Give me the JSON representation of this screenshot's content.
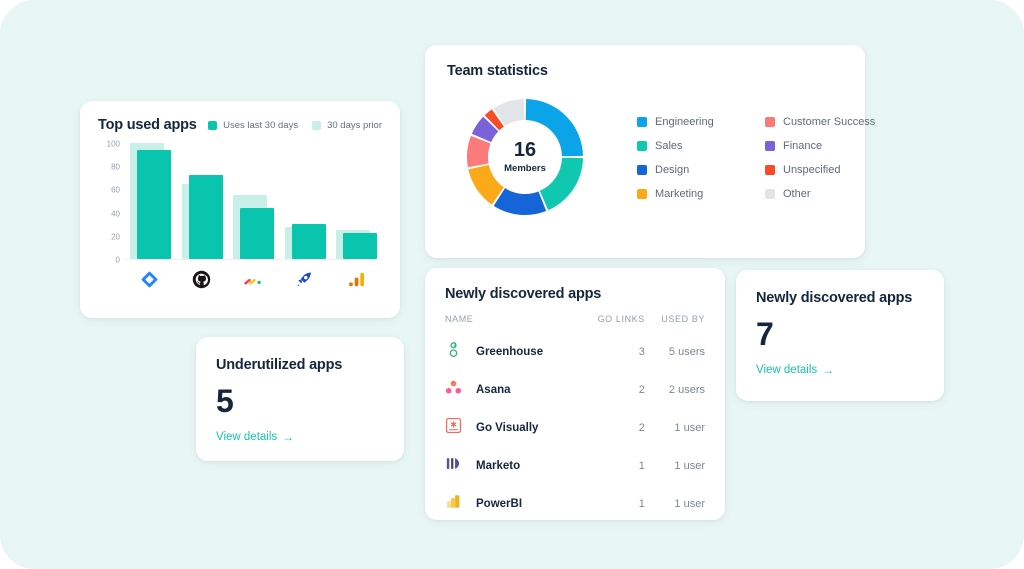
{
  "theme": {
    "background": "#e9f7f4",
    "card_background": "#ffffff",
    "text_dark": "#16263c",
    "text_muted": "#7b8893",
    "accent_teal": "#14c6ae"
  },
  "top_used_apps": {
    "title": "Top used apps",
    "legend": [
      {
        "label": "Uses last 30 days",
        "color": "#0ac5ad"
      },
      {
        "label": "30 days prior",
        "color": "#c9efe9"
      }
    ],
    "chart_data": {
      "type": "bar",
      "title": "Top used apps",
      "xlabel": "",
      "ylabel": "",
      "ylim": [
        0,
        100
      ],
      "yticks": [
        100,
        80,
        60,
        40,
        20,
        0
      ],
      "grid": false,
      "legend_position": "top-right",
      "categories": [
        "Jira",
        "GitHub",
        "Monday.com",
        "Salesloft",
        "Google Analytics"
      ],
      "series": [
        {
          "name": "Uses last 30 days",
          "color": "#0ac5ad",
          "values": [
            94,
            72,
            44,
            30,
            22
          ]
        },
        {
          "name": "30 days prior",
          "color": "#c9efe9",
          "values": [
            100,
            65,
            55,
            28,
            25
          ]
        }
      ]
    },
    "app_icons": [
      "jira-icon",
      "github-icon",
      "monday-icon",
      "salesloft-icon",
      "google-analytics-icon"
    ]
  },
  "team_statistics": {
    "title": "Team statistics",
    "center_value": "16",
    "center_caption": "Members",
    "chart_data": {
      "type": "pie",
      "title": "Team statistics",
      "total": 16,
      "total_label": "Members",
      "legend_position": "right",
      "categories": [
        "Engineering",
        "Sales",
        "Design",
        "Marketing",
        "Customer Success",
        "Finance",
        "Unspecified",
        "Other"
      ],
      "values": [
        4,
        3,
        2.5,
        2,
        1.5,
        1,
        0.5,
        1.5
      ],
      "colors": [
        "#0ca4e8",
        "#10c8b0",
        "#1565d8",
        "#fba918",
        "#fb7a7a",
        "#7b62db",
        "#f94b2a",
        "#e2e5e8"
      ]
    },
    "legend_left": [
      {
        "label": "Engineering",
        "color": "#0ca4e8"
      },
      {
        "label": "Sales",
        "color": "#10c8b0"
      },
      {
        "label": "Design",
        "color": "#1565d8"
      },
      {
        "label": "Marketing",
        "color": "#fba918"
      }
    ],
    "legend_right": [
      {
        "label": "Customer Success",
        "color": "#fb7a7a"
      },
      {
        "label": "Finance",
        "color": "#7b62db"
      },
      {
        "label": "Unspecified",
        "color": "#f94b2a"
      },
      {
        "label": "Other",
        "color": "#e2e5e8"
      }
    ]
  },
  "underutilized_apps": {
    "title": "Underutilized apps",
    "count": "5",
    "link_label": "View details",
    "link_arrow": "→"
  },
  "newly_discovered_count": {
    "title": "Newly discovered apps",
    "count": "7",
    "link_label": "View details",
    "link_arrow": "→"
  },
  "newly_discovered_table": {
    "title": "Newly discovered apps",
    "columns": [
      "NAME",
      "GO LINKS",
      "USED BY"
    ],
    "rows": [
      {
        "icon": "greenhouse-icon",
        "name": "Greenhouse",
        "go_links": "3",
        "used_by": "5 users"
      },
      {
        "icon": "asana-icon",
        "name": "Asana",
        "go_links": "2",
        "used_by": "2 users"
      },
      {
        "icon": "govisually-icon",
        "name": "Go Visually",
        "go_links": "2",
        "used_by": "1 user"
      },
      {
        "icon": "marketo-icon",
        "name": "Marketo",
        "go_links": "1",
        "used_by": "1 user"
      },
      {
        "icon": "powerbi-icon",
        "name": "PowerBI",
        "go_links": "1",
        "used_by": "1 user"
      }
    ]
  }
}
